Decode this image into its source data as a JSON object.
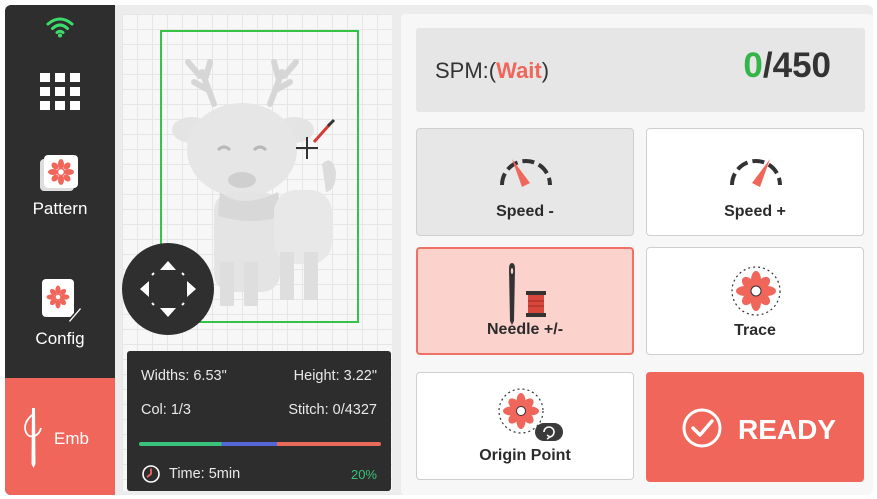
{
  "sidebar": {
    "wifi_icon": "wifi-icon",
    "menu_icon": "grid-menu-icon",
    "items": [
      {
        "label": "Pattern",
        "icon": "pattern-flower-icon"
      },
      {
        "label": "Config",
        "icon": "config-flower-pencil-icon"
      },
      {
        "label": "Emb",
        "icon": "needle-thread-icon",
        "active": true
      }
    ]
  },
  "preview": {
    "design": "deer-embroidery-design",
    "dpad_icon": "move-arrows-icon",
    "stats": {
      "widths": "Widths: 6.53\"",
      "height": "Height: 3.22\"",
      "col": "Col: 1/3",
      "stitch": "Stitch: 0/4327",
      "time": "Time: 5min",
      "percent": "20%"
    }
  },
  "spm": {
    "prefix": "SPM:(",
    "status": "Wait",
    "suffix": ")",
    "current": "0",
    "total": "/450"
  },
  "buttons": {
    "speed_down": "Speed -",
    "speed_up": "Speed +",
    "needle": "Needle +/-",
    "trace": "Trace",
    "origin": "Origin Point",
    "ready": "READY"
  },
  "colors": {
    "accent": "#f0665a",
    "green": "#35b44a",
    "sidebar": "#2e2e2e",
    "progress_green": "#39c279",
    "progress_blue": "#5566d6",
    "progress_red": "#e9695a"
  }
}
